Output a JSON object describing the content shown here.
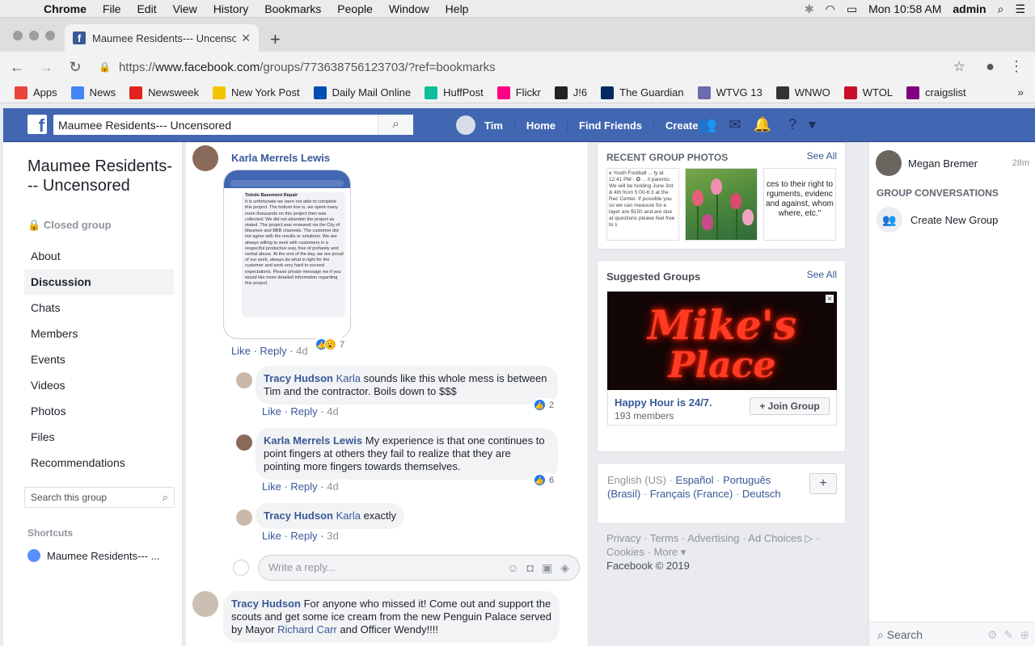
{
  "menubar": {
    "app": "Chrome",
    "items": [
      "File",
      "Edit",
      "View",
      "History",
      "Bookmarks",
      "People",
      "Window",
      "Help"
    ],
    "clock": "Mon 10:58 AM",
    "user": "admin"
  },
  "browser": {
    "tab_title": "Maumee Residents--- Uncensored",
    "url_scheme": "https://",
    "url_host": "www.facebook.com",
    "url_path": "/groups/773638756123703/?ref=bookmarks",
    "bookmarks": [
      {
        "label": "Apps",
        "color": "#e8453c"
      },
      {
        "label": "News",
        "color": "#4285f4"
      },
      {
        "label": "Newsweek",
        "color": "#e0231c"
      },
      {
        "label": "New York Post",
        "color": "#f5c400"
      },
      {
        "label": "Daily Mail Online",
        "color": "#004db3"
      },
      {
        "label": "HuffPost",
        "color": "#0dbe98"
      },
      {
        "label": "Flickr",
        "color": "#ff0084"
      },
      {
        "label": "J!6",
        "color": "#222222"
      },
      {
        "label": "The Guardian",
        "color": "#052962"
      },
      {
        "label": "WTVG 13",
        "color": "#6b6bb0"
      },
      {
        "label": "WNWO",
        "color": "#333333"
      },
      {
        "label": "WTOL",
        "color": "#c8102e"
      },
      {
        "label": "craigslist",
        "color": "#800080"
      }
    ]
  },
  "fb": {
    "search_value": "Maumee Residents--- Uncensored",
    "nav": {
      "user": "Tim",
      "home": "Home",
      "find_friends": "Find Friends",
      "create": "Create"
    }
  },
  "group": {
    "title": "Maumee Residents--- Uncensored",
    "type": "Closed group",
    "nav": [
      "About",
      "Discussion",
      "Chats",
      "Members",
      "Events",
      "Videos",
      "Photos",
      "Files",
      "Recommendations"
    ],
    "active_nav": "Discussion",
    "search_placeholder": "Search this group",
    "shortcuts_heading": "Shortcuts",
    "shortcut_item": "Maumee Residents--- ..."
  },
  "feed": {
    "top_comment": {
      "author": "Karla Merrels Lewis",
      "screenshot_title": "Toledo Basement Repair",
      "screenshot_text": "It is unfortunate we were not able to complete this project. The bottom line is, we spent many more thousands on this project then was collected. We did not abandon the project as stated. The project was reviewed via the City of Maumee and BBB channels. The customer did not agree with the results or solutions. We are always willing to work with customers in a respectful productive way, free of profanity and verbal abuse. At the end of the day, we are proud of our work, always do what is right for the customer and work very hard to exceed expectations. Please private message me if you would like more detailed information regarding this project.",
      "like": "Like",
      "reply": "Reply",
      "time": "4d",
      "reactions": "7"
    },
    "replies": [
      {
        "author": "Tracy Hudson",
        "tag": "Karla",
        "text": " sounds like this whole mess is between Tim and the contractor. Boils down to $$$",
        "time": "4d",
        "reactions": "2"
      },
      {
        "author": "Karla Merrels Lewis",
        "tag": "",
        "text": "My experience is that one continues to point fingers at others they fail to realize that they are pointing more fingers towards themselves.",
        "time": "4d",
        "reactions": "6"
      },
      {
        "author": "Tracy Hudson",
        "tag": "Karla",
        "text": " exactly",
        "time": "3d",
        "reactions": ""
      }
    ],
    "reply_placeholder": "Write a reply...",
    "bottom_comment": {
      "author": "Tracy Hudson",
      "text_a": "For anyone who missed it! Come out and support the scouts and get some ice cream from the new Penguin Palace served by Mayor ",
      "tag": "Richard Carr",
      "text_b": " and Officer Wendy!!!!"
    }
  },
  "right": {
    "photos_heading": "RECENT GROUP PHOTOS",
    "see_all": "See All",
    "photo1_text": "e Youth Football ... ly at 12:41 PM · ✪ ... ll parents: We will be holding June 3rd & 4th from 5:00-6:3 at the Rec Center. If possible you so we can measure for e layer are $150 and are due at questions please feel free to s",
    "photo3_text": "ces to their right to rguments, evidenc and against, whom where, etc.\"",
    "suggested_heading": "Suggested Groups",
    "ad_line1": "Mike's",
    "ad_line2": "Place",
    "ad_title": "Happy Hour is 24/7.",
    "ad_members": "193 members",
    "join": "Join Group",
    "lang_current": "English (US)",
    "langs": [
      "Español",
      "Português (Brasil)",
      "Français (France)",
      "Deutsch"
    ],
    "footer_links": "Privacy · Terms · Advertising · Ad Choices ▷ · Cookies · More ▾",
    "copyright": "Facebook © 2019"
  },
  "chat": {
    "user": "Megan Bremer",
    "time": "28m",
    "gc_heading": "GROUP CONVERSATIONS",
    "create_group": "Create New Group",
    "search": "Search"
  }
}
